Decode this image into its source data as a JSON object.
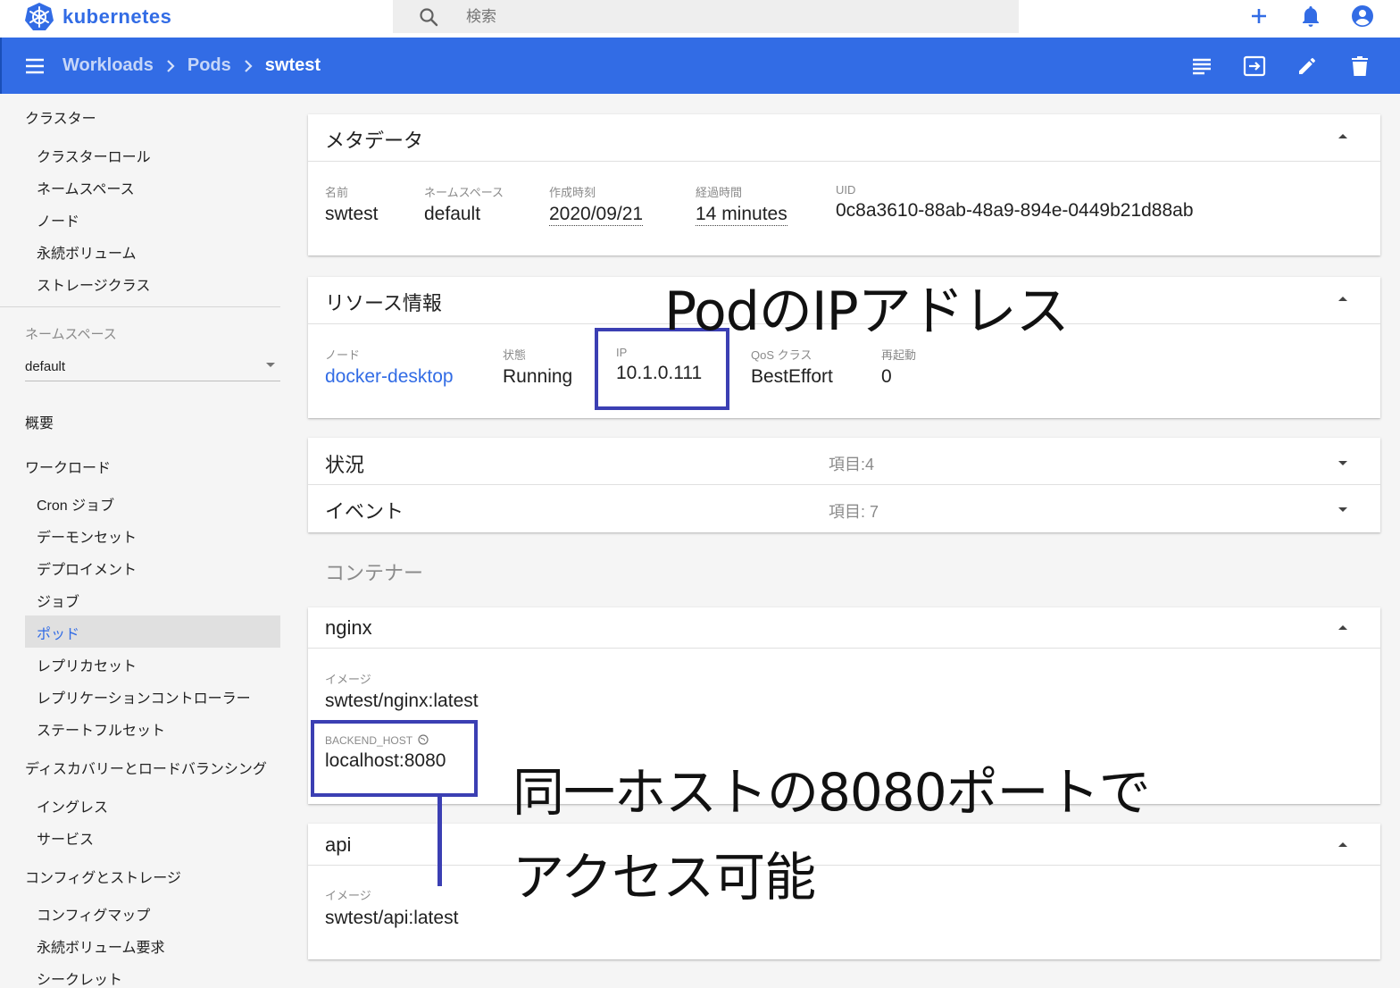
{
  "header": {
    "app_name": "kubernetes",
    "search_placeholder": "検索",
    "brand_color": "#326ce5"
  },
  "navbar": {
    "crumbs": [
      "Workloads",
      "Pods"
    ],
    "current": "swtest"
  },
  "sidebar": {
    "cluster_heading": "クラスター",
    "cluster_items": [
      "クラスターロール",
      "ネームスペース",
      "ノード",
      "永続ボリューム",
      "ストレージクラス"
    ],
    "namespace_label": "ネームスペース",
    "namespace_value": "default",
    "overview": "概要",
    "workloads_heading": "ワークロード",
    "workload_items": [
      "Cron ジョブ",
      "デーモンセット",
      "デプロイメント",
      "ジョブ",
      "ポッド",
      "レプリカセット",
      "レプリケーションコントローラー",
      "ステートフルセット"
    ],
    "discovery_heading": "ディスカバリーとロードバランシング",
    "discovery_items": [
      "イングレス",
      "サービス"
    ],
    "config_heading": "コンフィグとストレージ",
    "config_items": [
      "コンフィグマップ",
      "永続ボリューム要求",
      "シークレット"
    ]
  },
  "metadata": {
    "title": "メタデータ",
    "fields": [
      {
        "label": "名前",
        "value": "swtest"
      },
      {
        "label": "ネームスペース",
        "value": "default"
      },
      {
        "label": "作成時刻",
        "value": "2020/09/21"
      },
      {
        "label": "経過時間",
        "value": "14 minutes"
      },
      {
        "label": "UID",
        "value": "0c8a3610-88ab-48a9-894e-0449b21d88ab"
      }
    ]
  },
  "resource": {
    "title": "リソース情報",
    "fields": [
      {
        "label": "ノード",
        "value": "docker-desktop"
      },
      {
        "label": "状態",
        "value": "Running"
      },
      {
        "label": "IP",
        "value": "10.1.0.111"
      },
      {
        "label": "QoS クラス",
        "value": "BestEffort"
      },
      {
        "label": "再起動",
        "value": "0"
      }
    ]
  },
  "conditions": {
    "title": "状況",
    "count": "項目:4"
  },
  "events": {
    "title": "イベント",
    "count": "項目: 7"
  },
  "containers": {
    "section_title": "コンテナー",
    "nginx": {
      "name": "nginx",
      "image_label": "イメージ",
      "image": "swtest/nginx:latest",
      "env_label": "BACKEND_HOST",
      "env_value": "localhost:8080"
    },
    "api": {
      "name": "api",
      "image_label": "イメージ",
      "image": "swtest/api:latest"
    }
  },
  "annotations": {
    "ip_note": "PodのIPアドレス",
    "port_note_line1": "同一ホストの8080ポートで",
    "port_note_line2": "アクセス可能",
    "color": "#3b3fb3"
  }
}
